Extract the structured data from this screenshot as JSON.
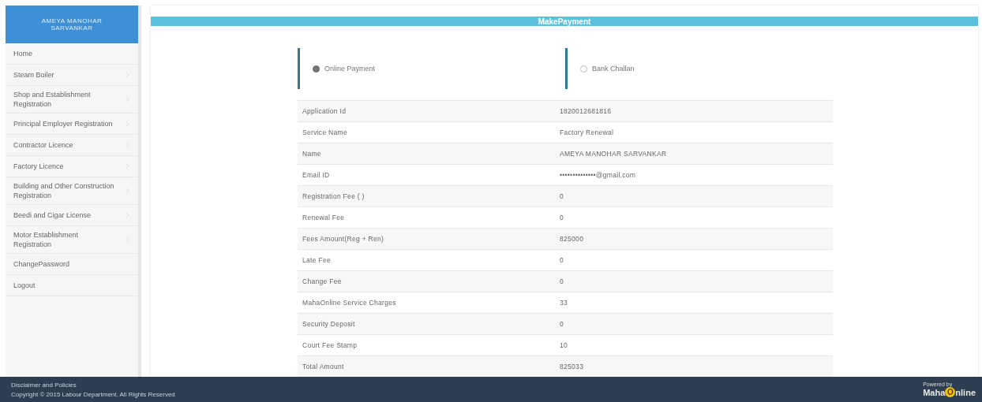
{
  "user": {
    "name": "AMEYA MANOHAR SARVANKAR"
  },
  "sidebar": {
    "items": [
      {
        "label": "Home",
        "has_arrow": false
      },
      {
        "label": "Steam Boiler",
        "has_arrow": true
      },
      {
        "label": "Shop and Establishment Registration",
        "has_arrow": true
      },
      {
        "label": "Principal Employer Registration",
        "has_arrow": true
      },
      {
        "label": "Contractor Licence",
        "has_arrow": true
      },
      {
        "label": "Factory Licence",
        "has_arrow": true
      },
      {
        "label": "Building and Other Construction Registration",
        "has_arrow": true
      },
      {
        "label": "Beedi and Cigar License",
        "has_arrow": true
      },
      {
        "label": "Motor Establishment Registration",
        "has_arrow": true
      },
      {
        "label": "ChangePassword",
        "has_arrow": false
      },
      {
        "label": "Logout",
        "has_arrow": false
      }
    ]
  },
  "page": {
    "title": "MakePayment"
  },
  "payment_options": [
    {
      "label": "Online Payment",
      "selected": true
    },
    {
      "label": "Bank Challan",
      "selected": false
    }
  ],
  "details": [
    {
      "label": "Application Id",
      "value": "1820012681816"
    },
    {
      "label": "Service Name",
      "value": "Factory Renewal"
    },
    {
      "label": "Name",
      "value": "AMEYA MANOHAR SARVANKAR"
    },
    {
      "label": "Email ID",
      "value": "••••••••••••••@gmail.com"
    },
    {
      "label": "Registration Fee ( )",
      "value": "0"
    },
    {
      "label": "Renewal Fee",
      "value": "0"
    },
    {
      "label": "Fees Amount(Reg + Ren)",
      "value": "825000"
    },
    {
      "label": "Late Fee",
      "value": "0"
    },
    {
      "label": "Change Fee",
      "value": "0"
    },
    {
      "label": "MahaOnline Service Charges",
      "value": "33"
    },
    {
      "label": "Security Deposit",
      "value": "0"
    },
    {
      "label": "Court Fee Stamp",
      "value": "10"
    },
    {
      "label": "Total Amount",
      "value": "825033"
    }
  ],
  "footer": {
    "links": [
      "Disclaimer and Policies"
    ],
    "copyright": "Copyright © 2015 Labour Department. All Rights Reserved",
    "powered_by": "Powered by",
    "logo_start": "Maha",
    "logo_mark": "O",
    "logo_end": "nline"
  }
}
